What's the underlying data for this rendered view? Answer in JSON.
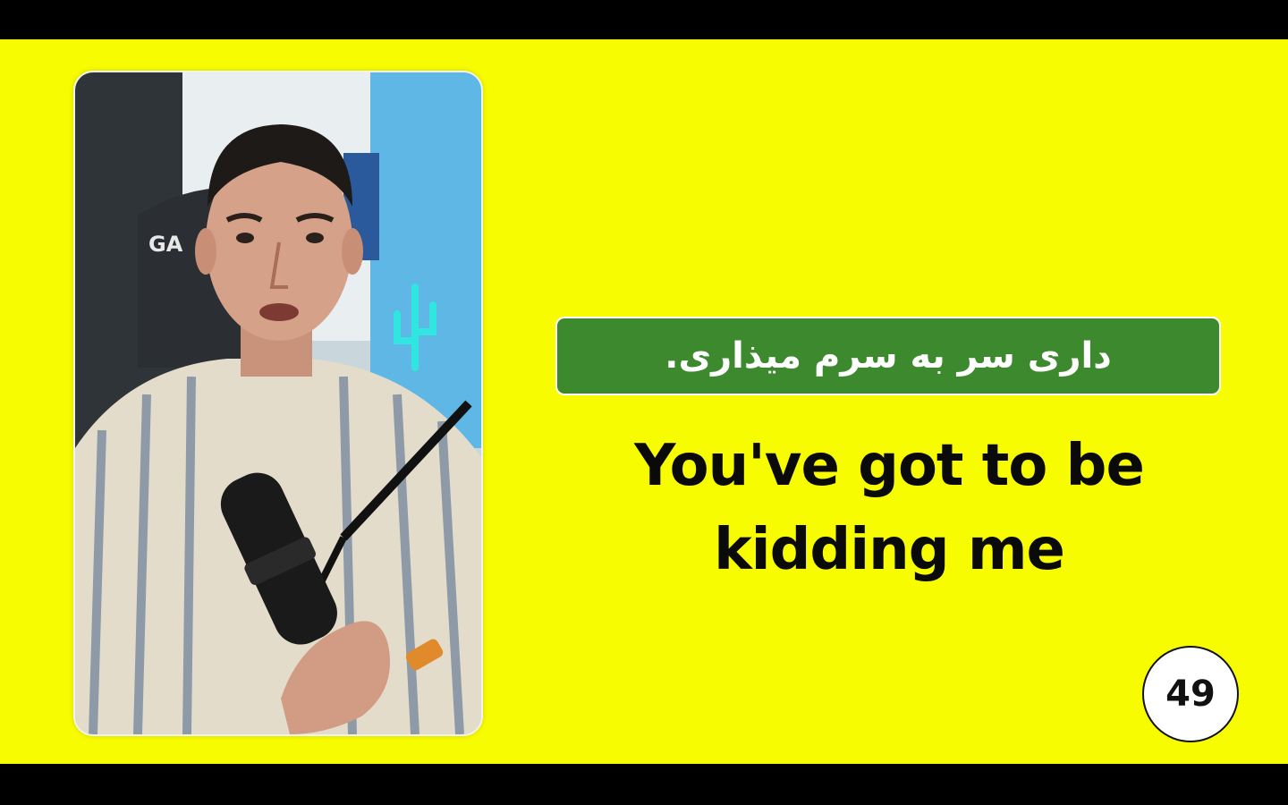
{
  "phrase": {
    "persian": "داری سر به سرم میذاری.",
    "english": "You've got to be kidding me"
  },
  "counter": "49",
  "video": {
    "chair_text": "GA"
  },
  "colors": {
    "background": "#f8fc00",
    "persian_box": "#3d8a2e",
    "letterbox": "#000000"
  }
}
